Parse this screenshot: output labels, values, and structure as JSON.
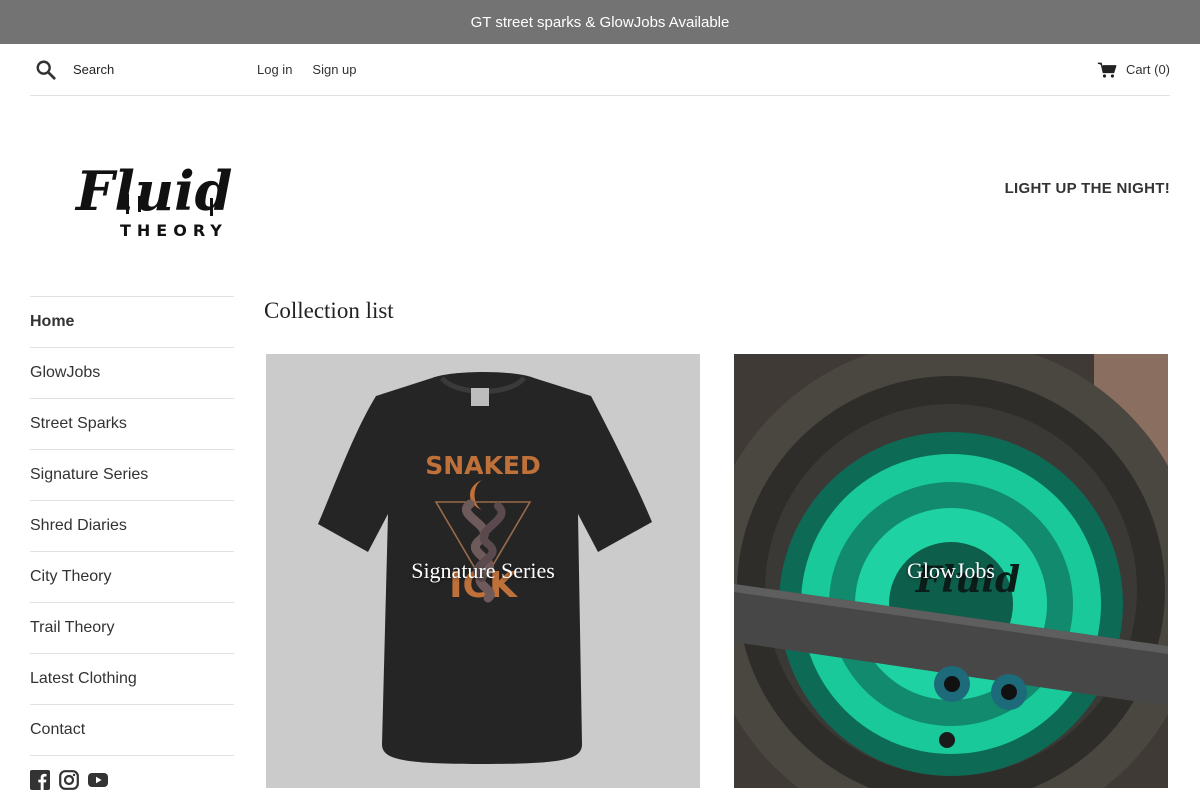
{
  "announcement": "GT street sparks & GlowJobs Available",
  "header": {
    "search_placeholder": "Search",
    "login": "Log in",
    "signup": "Sign up",
    "cart": "Cart (0)"
  },
  "brand": {
    "logo_word": "Fluid",
    "logo_sub": "THEORY",
    "tagline": "LIGHT UP THE NIGHT!"
  },
  "nav": {
    "items": [
      {
        "label": "Home",
        "active": true
      },
      {
        "label": "GlowJobs"
      },
      {
        "label": "Street Sparks"
      },
      {
        "label": "Signature Series"
      },
      {
        "label": "Shred Diaries"
      },
      {
        "label": "City Theory"
      },
      {
        "label": "Trail Theory"
      },
      {
        "label": "Latest Clothing"
      },
      {
        "label": "Contact"
      }
    ]
  },
  "social": [
    "facebook-icon",
    "instagram-icon",
    "youtube-icon"
  ],
  "main": {
    "title": "Collection list",
    "collections": [
      {
        "label": "Signature Series",
        "shirt_text_top": "SNAKED",
        "shirt_text_bottom": "ICK"
      },
      {
        "label": "GlowJobs",
        "wheel_text": "Fluid"
      }
    ]
  },
  "colors": {
    "announcement_bg": "#737373",
    "glow_green": "#19c99a",
    "shirt_print": "#c0713a"
  }
}
